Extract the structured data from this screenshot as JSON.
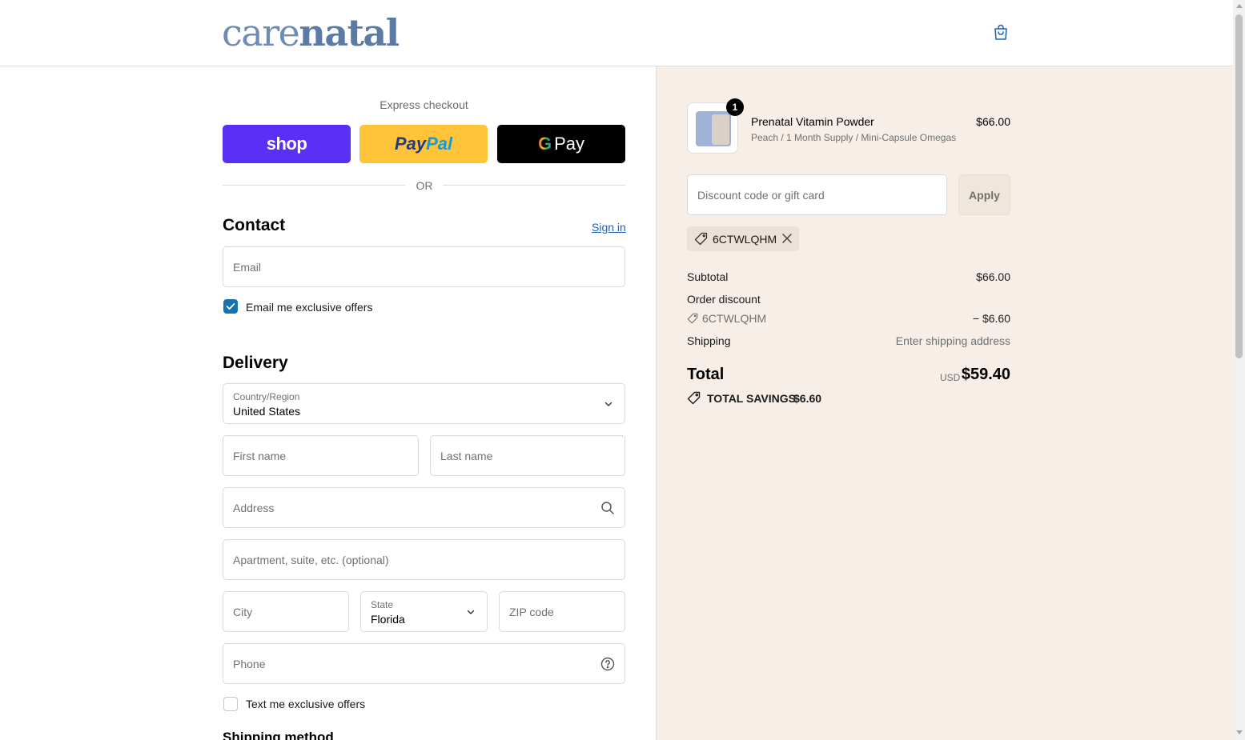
{
  "header": {
    "logo_light": "care",
    "logo_bold": "natal",
    "cart_icon": "shopping-bag-icon"
  },
  "express": {
    "label": "Express checkout",
    "shop_label": "shop",
    "paypal_part1": "Pay",
    "paypal_part2": "Pal",
    "gpay_g": "G",
    "gpay_label": "Pay",
    "or_label": "OR"
  },
  "contact": {
    "title": "Contact",
    "signin_label": "Sign in",
    "email_placeholder": "Email",
    "email_offers_label": "Email me exclusive offers",
    "email_offers_checked": true
  },
  "delivery": {
    "title": "Delivery",
    "country_label": "Country/Region",
    "country_value": "United States",
    "first_name_placeholder": "First name",
    "last_name_placeholder": "Last name",
    "address_placeholder": "Address",
    "apartment_placeholder": "Apartment, suite, etc. (optional)",
    "city_placeholder": "City",
    "state_label": "State",
    "state_value": "Florida",
    "zip_placeholder": "ZIP code",
    "phone_placeholder": "Phone",
    "sms_offers_label": "Text me exclusive offers",
    "sms_offers_checked": false,
    "shipping_method_title": "Shipping method"
  },
  "summary": {
    "product": {
      "quantity": "1",
      "name": "Prenatal Vitamin Powder",
      "variant": "Peach / 1 Month Supply / Mini-Capsule Omegas",
      "price": "$66.00"
    },
    "discount_placeholder": "Discount code or gift card",
    "apply_label": "Apply",
    "applied_code": "6CTWLQHM",
    "subtotal_label": "Subtotal",
    "subtotal_value": "$66.00",
    "order_discount_label": "Order discount",
    "order_discount_code": "6CTWLQHM",
    "order_discount_value": "− $6.60",
    "shipping_label": "Shipping",
    "shipping_value": "Enter shipping address",
    "total_label": "Total",
    "currency": "USD",
    "total_value": "$59.40",
    "savings_label": "TOTAL SAVINGS",
    "savings_value": "$6.60"
  },
  "colors": {
    "brand": "#5b7aa4",
    "shop_pay": "#5a31f4",
    "paypal": "#ffc439",
    "accent_link": "#1f63b8",
    "summary_bg": "#f6eee7"
  }
}
